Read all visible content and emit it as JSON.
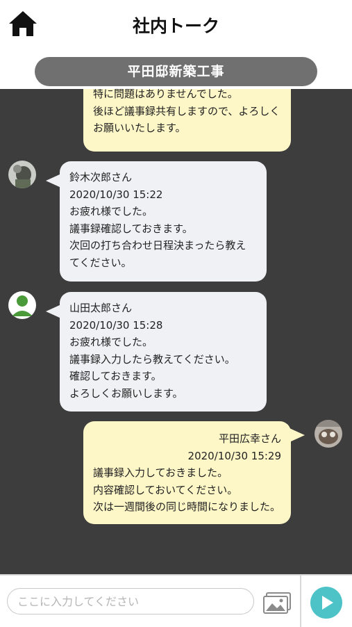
{
  "header": {
    "title": "社内トーク",
    "home_icon": "home-icon"
  },
  "room": {
    "name": "平田邸新築工事"
  },
  "messages": [
    {
      "direction": "outgoing",
      "sender": "",
      "timestamp": "",
      "lines": [
        "特に問題はありませんでした。",
        "後ほど議事録共有しますので、よろしく",
        "お願いいたします。"
      ]
    },
    {
      "direction": "incoming",
      "sender": "鈴木次郎さん",
      "timestamp": "2020/10/30 15:22",
      "lines": [
        "お疲れ様でした。",
        "議事録確認しておきます。",
        "次回の打ち合わせ日程決まったら教え",
        "てください。"
      ]
    },
    {
      "direction": "incoming",
      "sender": "山田太郎さん",
      "timestamp": "2020/10/30 15:28",
      "lines": [
        "お疲れ様でした。",
        "議事録入力したら教えてください。",
        "確認しておきます。",
        "よろしくお願いします。"
      ]
    },
    {
      "direction": "outgoing",
      "sender": "平田広幸さん",
      "timestamp": "2020/10/30 15:29",
      "lines": [
        "議事録入力しておきました。",
        "内容確認しておいてください。",
        "次は一週間後の同じ時間になりました。"
      ]
    }
  ],
  "composer": {
    "placeholder": "ここに入力してください",
    "image_icon": "image-icon",
    "send_icon": "send-icon"
  },
  "colors": {
    "chat_background": "#3d3d3d",
    "incoming_bubble": "#eff1f4",
    "outgoing_bubble": "#fdf6c7",
    "room_pill": "#707070",
    "send_button": "#4dc3c8"
  }
}
